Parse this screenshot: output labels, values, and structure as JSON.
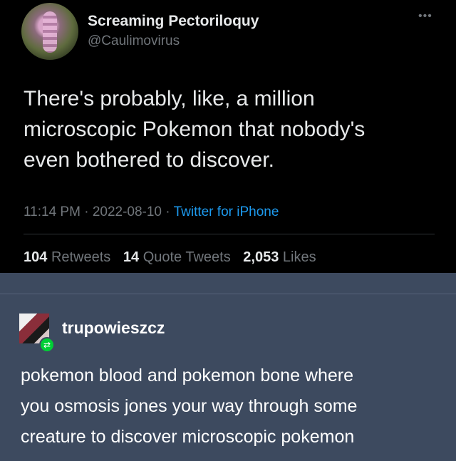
{
  "tweet": {
    "display_name": "Screaming Pectoriloquy",
    "handle": "@Caulimovirus",
    "more_icon": "more-dots-icon",
    "text": "There's probably, like, a million\nmicroscopic Pokemon that nobody's\neven bothered to discover.",
    "time": "11:14 PM",
    "date": "2022-08-10",
    "source": "Twitter for iPhone",
    "retweets_count": "104",
    "retweets_label": "Retweets",
    "quote_count": "14",
    "quote_label": "Quote Tweets",
    "likes_count": "2,053",
    "likes_label": "Likes"
  },
  "tumblr": {
    "username": "trupowieszcz",
    "reblog_icon": "reblog-icon",
    "body": "pokemon blood and pokemon bone where\nyou osmosis jones your way through some\ncreature to discover microscopic pokemon"
  },
  "colors": {
    "tweet_bg": "#000000",
    "tweet_text": "#e7e9ea",
    "muted": "#71767b",
    "link": "#1d9bf0",
    "tumblr_bg": "#3d4a5f",
    "reblog_green": "#00cf35"
  }
}
